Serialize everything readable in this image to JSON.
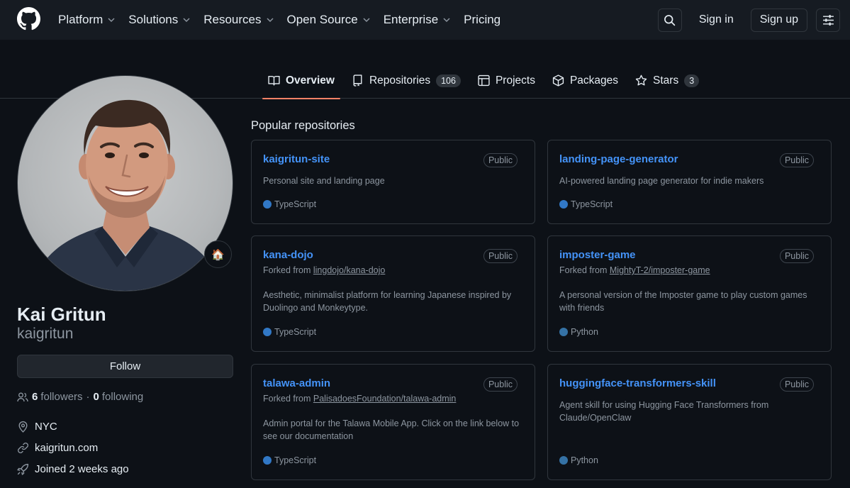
{
  "header": {
    "nav": [
      {
        "label": "Platform",
        "has_menu": true
      },
      {
        "label": "Solutions",
        "has_menu": true
      },
      {
        "label": "Resources",
        "has_menu": true
      },
      {
        "label": "Open Source",
        "has_menu": true
      },
      {
        "label": "Enterprise",
        "has_menu": true
      },
      {
        "label": "Pricing",
        "has_menu": false
      }
    ],
    "sign_in": "Sign in",
    "sign_up": "Sign up"
  },
  "tabs": [
    {
      "label": "Overview",
      "icon": "book-icon",
      "active": true
    },
    {
      "label": "Repositories",
      "icon": "repo-icon",
      "count": "106"
    },
    {
      "label": "Projects",
      "icon": "table-icon"
    },
    {
      "label": "Packages",
      "icon": "package-icon"
    },
    {
      "label": "Stars",
      "icon": "star-icon",
      "count": "3"
    }
  ],
  "profile": {
    "name": "Kai Gritun",
    "username": "kaigritun",
    "status_emoji": "🏠",
    "follow_label": "Follow",
    "followers_count": "6",
    "followers_label": "followers",
    "separator": "·",
    "following_count": "0",
    "following_label": "following",
    "location": "NYC",
    "website": "kaigritun.com",
    "joined": "Joined 2 weeks ago"
  },
  "popular": {
    "title": "Popular repositories",
    "forked_prefix": "Forked from",
    "repos": [
      {
        "name": "kaigritun-site",
        "visibility": "Public",
        "forked_from": "",
        "description": "Personal site and landing page",
        "language": "TypeScript",
        "lang_color": "#3178c6"
      },
      {
        "name": "landing-page-generator",
        "visibility": "Public",
        "forked_from": "",
        "description": "AI-powered landing page generator for indie makers",
        "language": "TypeScript",
        "lang_color": "#3178c6"
      },
      {
        "name": "kana-dojo",
        "visibility": "Public",
        "forked_from": "lingdojo/kana-dojo",
        "description": "Aesthetic, minimalist platform for learning Japanese inspired by Duolingo and Monkeytype.",
        "language": "TypeScript",
        "lang_color": "#3178c6"
      },
      {
        "name": "imposter-game",
        "visibility": "Public",
        "forked_from": "MightyT-2/imposter-game",
        "description": "A personal version of the Imposter game to play custom games with friends",
        "language": "Python",
        "lang_color": "#3572A5"
      },
      {
        "name": "talawa-admin",
        "visibility": "Public",
        "forked_from": "PalisadoesFoundation/talawa-admin",
        "description": "Admin portal for the Talawa Mobile App. Click on the link below to see our documentation",
        "language": "TypeScript",
        "lang_color": "#3178c6"
      },
      {
        "name": "huggingface-transformers-skill",
        "visibility": "Public",
        "forked_from": "",
        "description": "Agent skill for using Hugging Face Transformers from Claude/OpenClaw",
        "language": "Python",
        "lang_color": "#3572A5"
      }
    ]
  }
}
